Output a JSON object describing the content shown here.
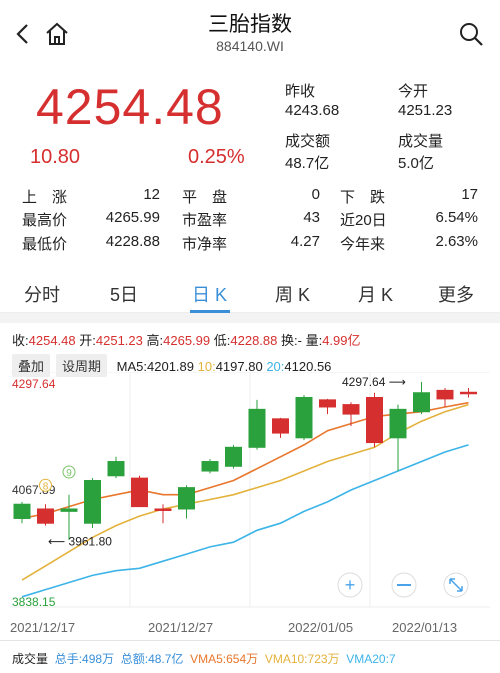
{
  "header": {
    "title": "三胎指数",
    "code": "884140.WI"
  },
  "quote": {
    "price": "4254.48",
    "change": "10.80",
    "change_pct": "0.25%",
    "prev_close_label": "昨收",
    "prev_close": "4243.68",
    "open_label": "今开",
    "open": "4251.23",
    "turnover_label": "成交额",
    "turnover": "48.7亿",
    "volume_label": "成交量",
    "volume": "5.0亿"
  },
  "stats": {
    "up_label": "上　涨",
    "up": "12",
    "flat_label": "平　盘",
    "flat": "0",
    "down_label": "下　跌",
    "down": "17",
    "high_label": "最高价",
    "high": "4265.99",
    "pe_label": "市盈率",
    "pe": "43",
    "d20_label": "近20日",
    "d20": "6.54%",
    "low_label": "最低价",
    "low": "4228.88",
    "pb_label": "市净率",
    "pb": "4.27",
    "ytd_label": "今年来",
    "ytd": "2.63%"
  },
  "tabs": [
    "分时",
    "5日",
    "日 K",
    "周 K",
    "月 K",
    "更多"
  ],
  "kline_info": {
    "close_label": "收:",
    "close": "4254.48",
    "open_label": "开:",
    "open": "4251.23",
    "high_label": "高:",
    "high": "4265.99",
    "low_label": "低:",
    "low": "4228.88",
    "turnover_label": "换:-",
    "vol_label": "量:",
    "vol": "4.99亿"
  },
  "ma": {
    "overlay_btn": "叠加",
    "period_btn": "设周期",
    "ma5_label": "MA5:",
    "ma5": "4201.89",
    "ma10_label": "10:",
    "ma10": "4197.80",
    "ma20_label": "20:",
    "ma20": "4120.56"
  },
  "chart_data": {
    "type": "candlestick",
    "y_axis_labels": [
      "4297.64",
      "4067.89",
      "3838.15"
    ],
    "annotations": {
      "max": "4297.64",
      "min": "3961.80"
    },
    "markers": [
      "8",
      "9"
    ],
    "x_labels": [
      "2021/12/17",
      "2021/12/27",
      "2022/01/05",
      "2022/01/13"
    ],
    "candles": [
      {
        "o": 4040,
        "c": 4010,
        "h": 4045,
        "l": 4000
      },
      {
        "o": 4000,
        "c": 4030,
        "h": 4040,
        "l": 3995
      },
      {
        "o": 4030,
        "c": 4025,
        "h": 4060,
        "l": 3965
      },
      {
        "o": 4090,
        "c": 4000,
        "h": 4095,
        "l": 3990
      },
      {
        "o": 4130,
        "c": 4100,
        "h": 4140,
        "l": 4095
      },
      {
        "o": 4035,
        "c": 4095,
        "h": 4100,
        "l": 4035
      },
      {
        "o": 4030,
        "c": 4030,
        "h": 4040,
        "l": 4000
      },
      {
        "o": 4075,
        "c": 4030,
        "h": 4080,
        "l": 4010
      },
      {
        "o": 4130,
        "c": 4110,
        "h": 4135,
        "l": 4105
      },
      {
        "o": 4160,
        "c": 4120,
        "h": 4165,
        "l": 4115
      },
      {
        "o": 4240,
        "c": 4160,
        "h": 4260,
        "l": 4155
      },
      {
        "o": 4190,
        "c": 4220,
        "h": 4222,
        "l": 4180
      },
      {
        "o": 4265,
        "c": 4180,
        "h": 4270,
        "l": 4175
      },
      {
        "o": 4245,
        "c": 4260,
        "h": 4262,
        "l": 4230
      },
      {
        "o": 4230,
        "c": 4250,
        "h": 4255,
        "l": 4205
      },
      {
        "o": 4170,
        "c": 4265,
        "h": 4275,
        "l": 4160
      },
      {
        "o": 4240,
        "c": 4180,
        "h": 4250,
        "l": 4110
      },
      {
        "o": 4275,
        "c": 4235,
        "h": 4298,
        "l": 4230
      },
      {
        "o": 4262,
        "c": 4280,
        "h": 4285,
        "l": 4245
      },
      {
        "o": 4276,
        "c": 4276,
        "h": 4285,
        "l": 4265
      }
    ],
    "ma5": [
      4010,
      4020,
      4035,
      4050,
      4060,
      4070,
      4060,
      4060,
      4075,
      4090,
      4115,
      4140,
      4165,
      4195,
      4210,
      4225,
      4230,
      4235,
      4245,
      4254
    ],
    "ma10": [
      3880,
      3910,
      3940,
      3970,
      3995,
      4015,
      4030,
      4040,
      4050,
      4060,
      4075,
      4090,
      4110,
      4130,
      4145,
      4160,
      4190,
      4215,
      4235,
      4250
    ],
    "ma20": [
      3845,
      3860,
      3875,
      3890,
      3900,
      3905,
      3920,
      3935,
      3950,
      3960,
      3985,
      4000,
      4025,
      4045,
      4070,
      4090,
      4110,
      4130,
      4150,
      4165
    ]
  },
  "volume_bar": {
    "label": "成交量",
    "hands_label": "总手:",
    "hands": "498万",
    "amount_label": "总额:",
    "amount": "48.7亿",
    "vma5_label": "VMA5:",
    "vma5": "654万",
    "vma10_label": "VMA10:",
    "vma10": "723万",
    "vma20_label": "VMA20:",
    "vma20": "7"
  },
  "colors": {
    "up": "#d62f2f",
    "down": "#2aa13c",
    "ma5": "#e8762c",
    "ma10": "#e3b23c",
    "ma20": "#3cb4e8",
    "accent": "#3a8fd8"
  }
}
